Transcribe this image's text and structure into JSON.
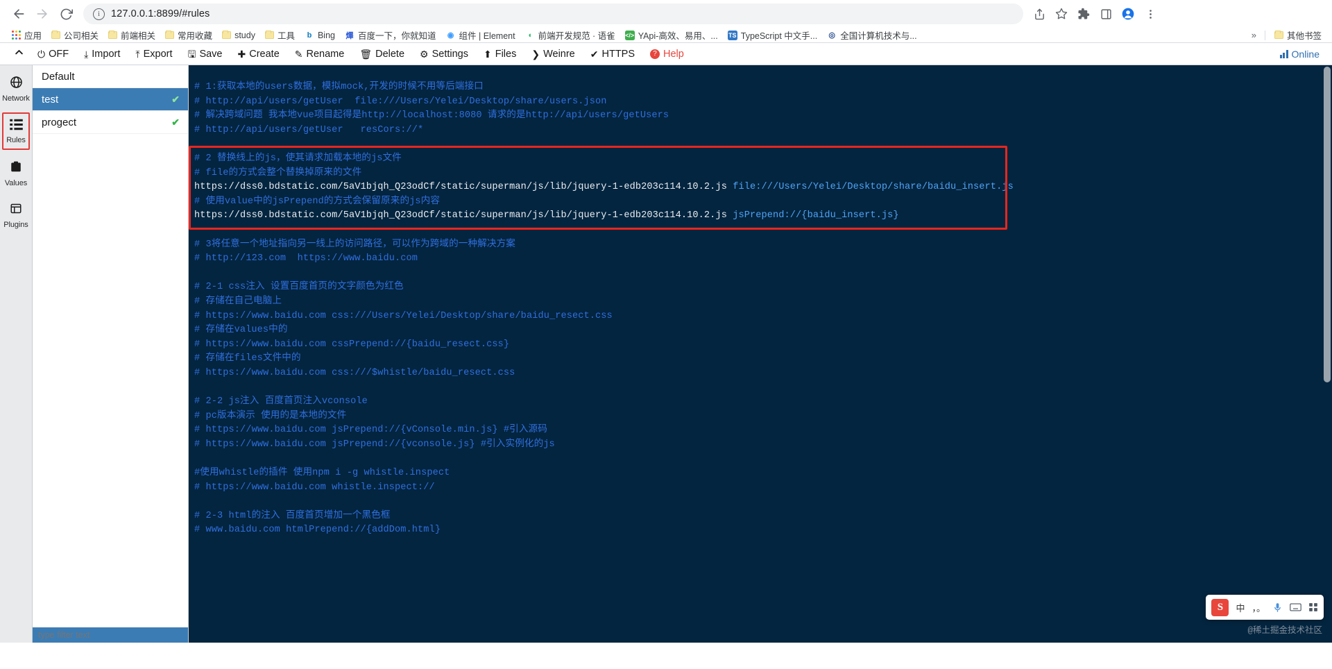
{
  "browser": {
    "nav": {
      "back_label": "Back",
      "forward_label": "Forward",
      "reload_label": "Reload"
    },
    "omnibox": {
      "host": "127.0.0.1:8899",
      "path": "/#rules",
      "full_url": "127.0.0.1:8899/#rules",
      "info_icon": "i"
    },
    "right_icons": [
      {
        "name": "share-icon",
        "glyph": "⇧"
      },
      {
        "name": "bookmark-star-icon",
        "glyph": "☆"
      },
      {
        "name": "extensions-puzzle-icon",
        "glyph": "❖"
      },
      {
        "name": "sidepanel-icon",
        "glyph": "◫"
      },
      {
        "name": "profile-avatar-icon",
        "glyph": "●"
      },
      {
        "name": "menu-kebab-icon",
        "glyph": "⋮"
      }
    ],
    "bookmarks": [
      {
        "label": "应用",
        "icon": "apps-grid-icon",
        "type": "apps"
      },
      {
        "label": "公司相关",
        "icon": "folder-icon",
        "type": "folder"
      },
      {
        "label": "前端相关",
        "icon": "folder-icon",
        "type": "folder"
      },
      {
        "label": "常用收藏",
        "icon": "folder-icon",
        "type": "folder"
      },
      {
        "label": "study",
        "icon": "folder-icon",
        "type": "folder"
      },
      {
        "label": "工具",
        "icon": "folder-icon",
        "type": "folder"
      },
      {
        "label": "Bing",
        "icon": "bing-favicon",
        "type": "site",
        "color": "#ffffff",
        "text": "b",
        "textColor": "#0b7dc1"
      },
      {
        "label": "百度一下，你就知道",
        "icon": "baidu-favicon",
        "type": "site",
        "color": "#ffffff",
        "text": "熚",
        "textColor": "#2d5bd6"
      },
      {
        "label": "组件 | Element",
        "icon": "element-favicon",
        "type": "site",
        "color": "#ffffff",
        "text": "◉",
        "textColor": "#409eff"
      },
      {
        "label": "前端开发规范 · 语雀",
        "icon": "yuque-favicon",
        "type": "site",
        "color": "#ffffff",
        "text": "◖",
        "textColor": "#25b864"
      },
      {
        "label": "YApi-高效、易用、...",
        "icon": "yapi-favicon",
        "type": "site",
        "color": "#3fae4e",
        "text": "</>",
        "textColor": "#ffffff"
      },
      {
        "label": "TypeScript 中文手...",
        "icon": "typescript-favicon",
        "type": "site",
        "color": "#3178c6",
        "text": "TS",
        "textColor": "#ffffff"
      },
      {
        "label": "全国计算机技术与...",
        "icon": "ncre-favicon",
        "type": "site",
        "color": "#ffffff",
        "text": "◎",
        "textColor": "#2a4f8f"
      }
    ],
    "bookmarks_overflow_label": "»",
    "other_bookmarks_label": "其他书签"
  },
  "toolbar": {
    "collapse_icon": "chevron-up-icon",
    "items": [
      {
        "label": "OFF",
        "icon": "power-icon",
        "glyph": "⏻"
      },
      {
        "label": "Import",
        "icon": "import-icon",
        "glyph": "⤓"
      },
      {
        "label": "Export",
        "icon": "export-icon",
        "glyph": "⤒"
      },
      {
        "label": "Save",
        "icon": "save-icon",
        "glyph": "🖫"
      },
      {
        "label": "Create",
        "icon": "plus-icon",
        "glyph": "✚"
      },
      {
        "label": "Rename",
        "icon": "edit-icon",
        "glyph": "✎"
      },
      {
        "label": "Delete",
        "icon": "trash-icon",
        "glyph": "🗑"
      },
      {
        "label": "Settings",
        "icon": "gear-icon",
        "glyph": "⚙"
      },
      {
        "label": "Files",
        "icon": "upload-circle-icon",
        "glyph": "⬆"
      },
      {
        "label": "Weinre",
        "icon": "chevron-right-icon",
        "glyph": "❯"
      },
      {
        "label": "HTTPS",
        "icon": "check-icon",
        "glyph": "✔"
      },
      {
        "label": "Help",
        "icon": "help-icon",
        "glyph": "?"
      }
    ],
    "status_label": "Online",
    "status_icon": "signal-bars-icon",
    "accent_color": "#2f6fae",
    "help_color": "#e8453c"
  },
  "sidebar": {
    "items": [
      {
        "label": "Network",
        "icon": "globe-icon",
        "active": false
      },
      {
        "label": "Rules",
        "icon": "list-icon",
        "active": true
      },
      {
        "label": "Values",
        "icon": "clipboard-icon",
        "active": false
      },
      {
        "label": "Plugins",
        "icon": "plugin-icon",
        "active": false
      }
    ],
    "active_outline_color": "#e03b38"
  },
  "rules_list": {
    "items": [
      {
        "label": "Default",
        "selected": false,
        "enabled": false
      },
      {
        "label": "test",
        "selected": true,
        "enabled": true
      },
      {
        "label": "progect",
        "selected": false,
        "enabled": true
      }
    ],
    "check_glyph": "✔",
    "filter_placeholder": "type filter text",
    "selected_color": "#3c7cb4"
  },
  "editor": {
    "lines": [
      {
        "type": "comment",
        "text": "# 1:获取本地的users数据，模拟mock,开发的时候不用等后端接口"
      },
      {
        "type": "comment",
        "text": "# http://api/users/getUser  file:///Users/Yelei/Desktop/share/users.json"
      },
      {
        "type": "comment",
        "text": "# 解决跨域问题 我本地vue项目起得是http://localhost:8080 请求的是http://api/users/getUsers"
      },
      {
        "type": "comment",
        "text": "# http://api/users/getUser   resCors://*"
      },
      {
        "type": "blank",
        "text": ""
      },
      {
        "type": "comment",
        "text": "# 2 替换线上的js，使其请求加载本地的js文件"
      },
      {
        "type": "comment",
        "text": "# file的方式会整个替换掉原来的文件"
      },
      {
        "type": "rule",
        "url": "https://dss0.bdstatic.com/5aV1bjqh_Q23odCf/static/superman/js/lib/jquery-1-edb203c114.10.2.js",
        "value": "file:///Users/Yelei/Desktop/share/baidu_insert.js"
      },
      {
        "type": "comment",
        "text": "# 使用value中的jsPrepend的方式会保留原来的js内容"
      },
      {
        "type": "rule",
        "url": "https://dss0.bdstatic.com/5aV1bjqh_Q23odCf/static/superman/js/lib/jquery-1-edb203c114.10.2.js",
        "value": "jsPrepend://{baidu_insert.js}"
      },
      {
        "type": "blank",
        "text": ""
      },
      {
        "type": "comment",
        "text": "# 3将任意一个地址指向另一线上的访问路径，可以作为跨域的一种解决方案"
      },
      {
        "type": "comment",
        "text": "# http://123.com  https://www.baidu.com"
      },
      {
        "type": "blank",
        "text": ""
      },
      {
        "type": "comment",
        "text": "# 2-1 css注入 设置百度首页的文字颜色为红色"
      },
      {
        "type": "comment",
        "text": "# 存储在自己电脑上"
      },
      {
        "type": "comment",
        "text": "# https://www.baidu.com css:///Users/Yelei/Desktop/share/baidu_resect.css"
      },
      {
        "type": "comment",
        "text": "# 存储在values中的"
      },
      {
        "type": "comment",
        "text": "# https://www.baidu.com cssPrepend://{baidu_resect.css}"
      },
      {
        "type": "comment",
        "text": "# 存储在files文件中的"
      },
      {
        "type": "comment",
        "text": "# https://www.baidu.com css:///$whistle/baidu_resect.css"
      },
      {
        "type": "blank",
        "text": ""
      },
      {
        "type": "comment",
        "text": "# 2-2 js注入 百度首页注入vconsole"
      },
      {
        "type": "comment",
        "text": "# pc版本演示 使用的是本地的文件"
      },
      {
        "type": "comment",
        "text": "# https://www.baidu.com jsPrepend://{vConsole.min.js} #引入源码"
      },
      {
        "type": "comment",
        "text": "# https://www.baidu.com jsPrepend://{vconsole.js} #引入实例化的js"
      },
      {
        "type": "blank",
        "text": ""
      },
      {
        "type": "comment",
        "text": "#使用whistle的插件 使用npm i -g whistle.inspect"
      },
      {
        "type": "comment",
        "text": "# https://www.baidu.com whistle.inspect://"
      },
      {
        "type": "blank",
        "text": ""
      },
      {
        "type": "comment",
        "text": "# 2-3 html的注入 百度首页增加一个黑色框"
      },
      {
        "type": "comment",
        "text": "# www.baidu.com htmlPrepend://{addDom.html}"
      }
    ],
    "highlight_box_color": "#e8261f",
    "background": "#04253f",
    "comment_color": "#2f6fe0",
    "url_color": "#e9edf2",
    "value_color": "#4fa3f7"
  },
  "overlay": {
    "ime_name": "sogou-input-widget",
    "ime_logo_text": "S",
    "ime_lang_label": "中",
    "ime_punct_label": "，。",
    "ime_mic_icon": "microphone-icon",
    "ime_keyboard_icon": "keyboard-icon",
    "ime_apps_icon": "apps-grid-icon",
    "watermark": "@稀土掘金技术社区"
  }
}
